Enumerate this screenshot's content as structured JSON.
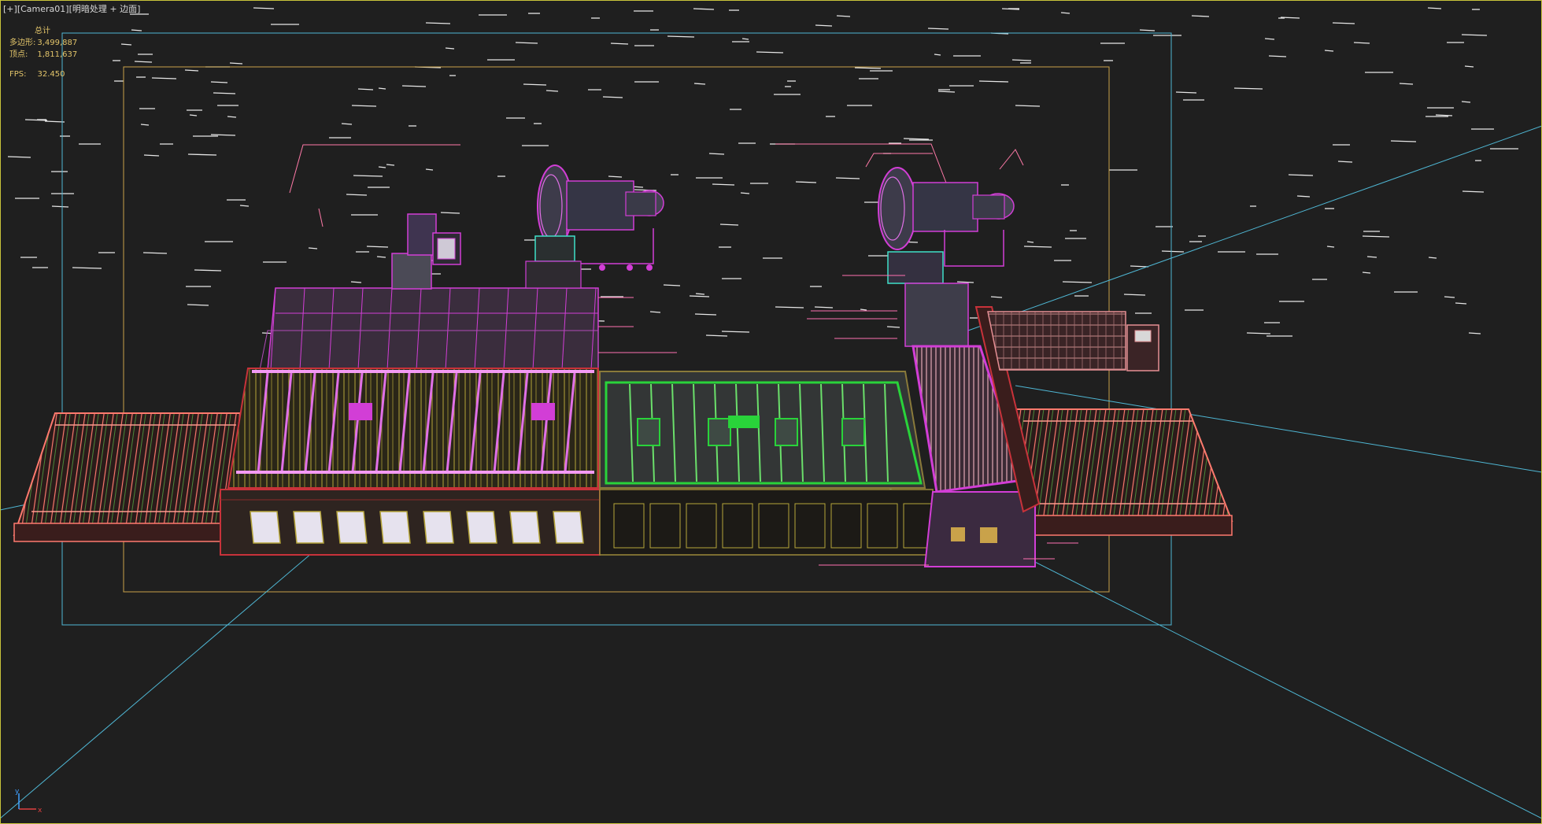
{
  "viewport": {
    "menu_label": "[+]",
    "camera_label": "[Camera01]",
    "shading_label": "[明暗处理 + 边面]"
  },
  "stats": {
    "header": "总计",
    "polys_label": "多边形:",
    "polys_value": "3,499,887",
    "verts_label": "顶点:",
    "verts_value": "1,811,637",
    "fps_label": "FPS:",
    "fps_value": "32.450"
  },
  "gizmo": {
    "x_label": "x",
    "y_label": "y"
  },
  "colors": {
    "background": "#1f1f1f",
    "viewport_border": "#c9c43b",
    "safe_frame_outer": "#4fb7d4",
    "safe_frame_inner": "#c9a24a",
    "stats_text": "#e2c46a",
    "wire_magenta": "#d23ed6",
    "wire_green": "#29d33a",
    "wire_salmon": "#ff7a6e",
    "wire_yellow": "#b6a53a",
    "wire_red": "#c8323a"
  },
  "scene_objects": [
    "conveyor-left",
    "furnace-heating-section",
    "exhaust-duct-left",
    "blower-fan-left",
    "quench-cooling-section",
    "blower-fan-right",
    "roller-drive-unit",
    "control-cabinets",
    "conveyor-right"
  ]
}
